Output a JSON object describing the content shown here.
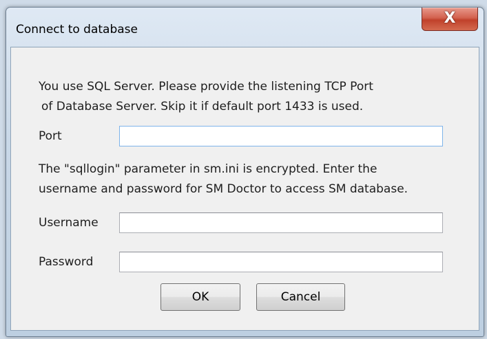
{
  "window": {
    "title": "Connect to database",
    "close_glyph": "X"
  },
  "dialog": {
    "intro_line1": "You use SQL Server. Please provide the listening TCP Port",
    "intro_line2": "of Database Server. Skip it if default port 1433 is used.",
    "port_label": "Port",
    "port_value": "",
    "encrypted_line1": "The \"sqllogin\" parameter in sm.ini is encrypted. Enter the",
    "encrypted_line2": "username and password for SM Doctor to access SM database.",
    "username_label": "Username",
    "username_value": "",
    "password_label": "Password",
    "password_value": ""
  },
  "buttons": {
    "ok_label": "OK",
    "cancel_label": "Cancel"
  },
  "icons": {
    "close": "close-icon"
  }
}
